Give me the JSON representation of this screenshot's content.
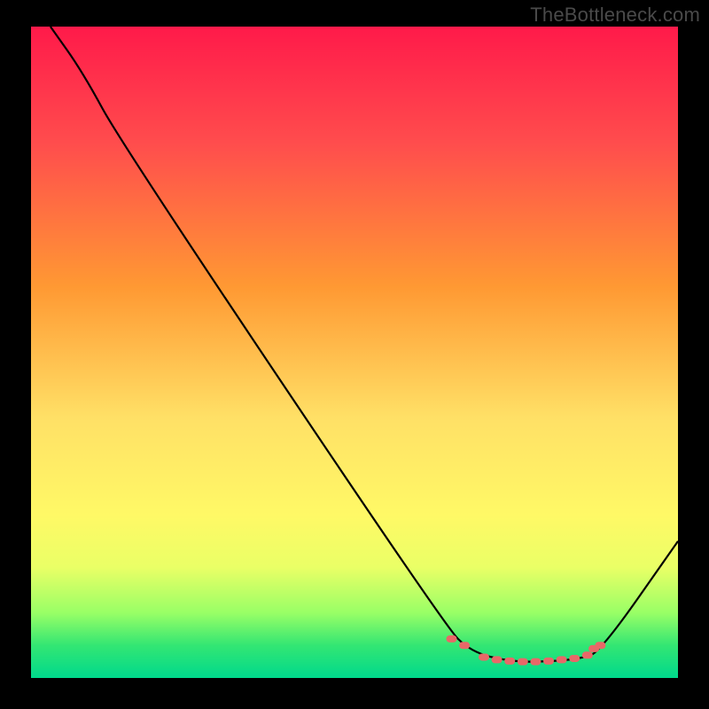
{
  "watermark": "TheBottleneck.com",
  "chart_data": {
    "type": "line",
    "title": "",
    "xlabel": "",
    "ylabel": "",
    "xlim": [
      0,
      100
    ],
    "ylim": [
      0,
      100
    ],
    "gradient_stops": [
      {
        "offset": 0,
        "color": "#ff1a4a"
      },
      {
        "offset": 18,
        "color": "#ff4d4d"
      },
      {
        "offset": 40,
        "color": "#ff9933"
      },
      {
        "offset": 60,
        "color": "#ffe066"
      },
      {
        "offset": 75,
        "color": "#fff966"
      },
      {
        "offset": 83,
        "color": "#eaff66"
      },
      {
        "offset": 90,
        "color": "#99ff66"
      },
      {
        "offset": 95,
        "color": "#33e673"
      },
      {
        "offset": 100,
        "color": "#00d98c"
      }
    ],
    "series": [
      {
        "name": "bottleneck-curve",
        "color": "#000000",
        "points": [
          {
            "x": 3,
            "y": 100
          },
          {
            "x": 8,
            "y": 93
          },
          {
            "x": 14,
            "y": 82
          },
          {
            "x": 64,
            "y": 8
          },
          {
            "x": 68,
            "y": 4
          },
          {
            "x": 74,
            "y": 2.5
          },
          {
            "x": 80,
            "y": 2.5
          },
          {
            "x": 85,
            "y": 3
          },
          {
            "x": 88,
            "y": 4
          },
          {
            "x": 100,
            "y": 21
          }
        ]
      }
    ],
    "valley_markers": [
      {
        "x": 65,
        "y": 6
      },
      {
        "x": 67,
        "y": 5
      },
      {
        "x": 70,
        "y": 3.2
      },
      {
        "x": 72,
        "y": 2.8
      },
      {
        "x": 74,
        "y": 2.6
      },
      {
        "x": 76,
        "y": 2.5
      },
      {
        "x": 78,
        "y": 2.5
      },
      {
        "x": 80,
        "y": 2.6
      },
      {
        "x": 82,
        "y": 2.8
      },
      {
        "x": 84,
        "y": 3.0
      },
      {
        "x": 86,
        "y": 3.5
      },
      {
        "x": 87,
        "y": 4.5
      },
      {
        "x": 88,
        "y": 5.0
      }
    ],
    "marker_color": "#e86868",
    "plot_background": "gradient",
    "grid": false,
    "legend": false
  }
}
